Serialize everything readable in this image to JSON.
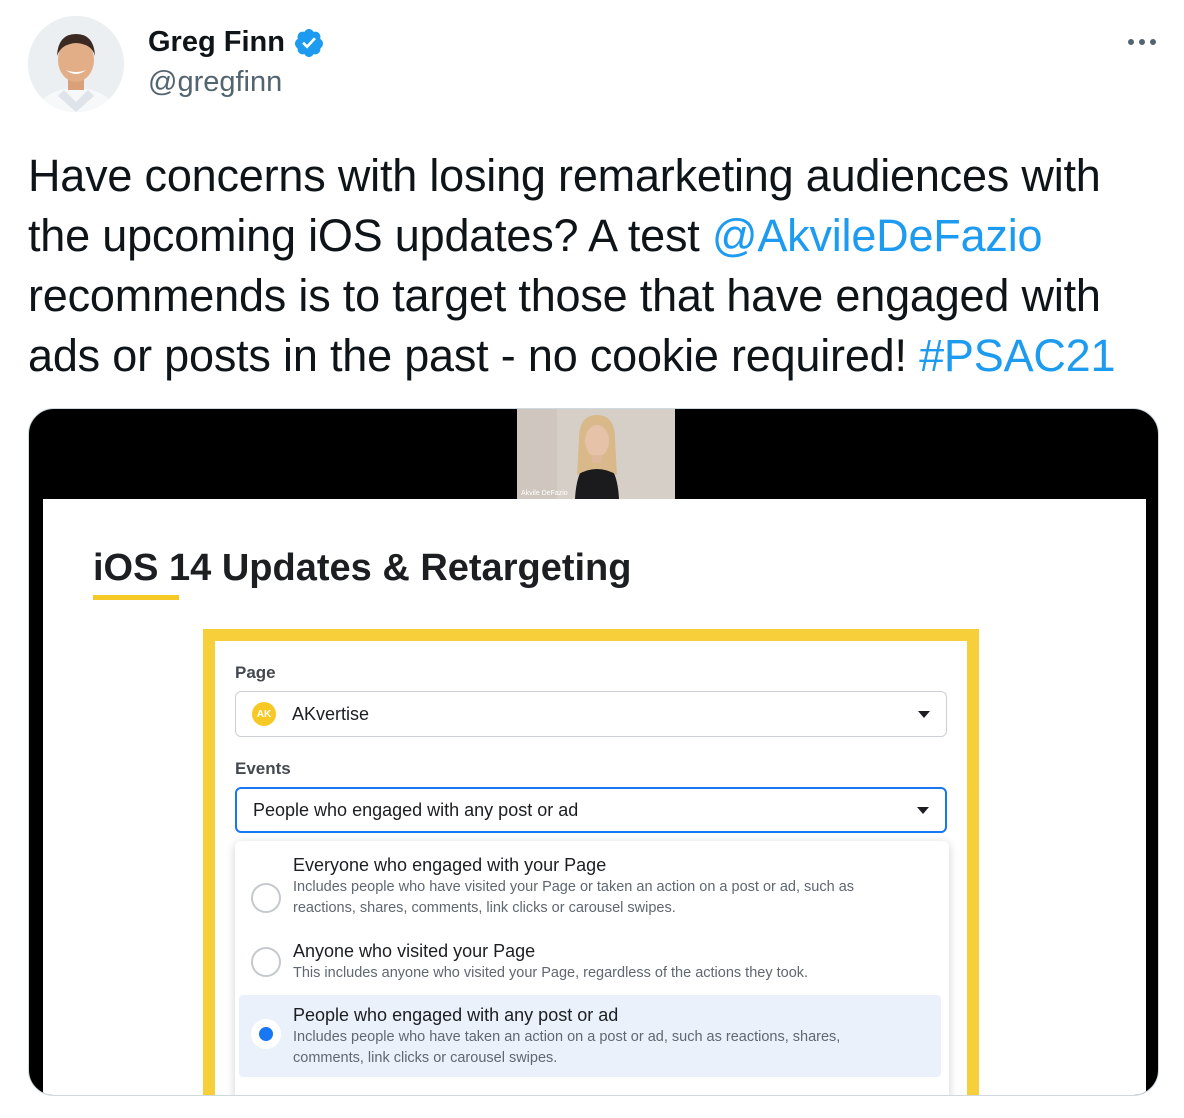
{
  "author": {
    "name": "Greg Finn",
    "handle": "@gregfinn"
  },
  "tweet": {
    "text_1": "Have concerns with losing remarketing audiences with the upcoming iOS updates? A test ",
    "mention": "@AkvileDeFazio",
    "text_2": " recommends is to target those that have engaged with ads or posts in the past - no cookie required!  ",
    "hashtag": "#PSAC21"
  },
  "media": {
    "webcam_caption": "Akvile DeFazio",
    "slide_title": "iOS 14 Updates & Retargeting",
    "form": {
      "page_label": "Page",
      "page_value": "AKvertise",
      "page_logo_text": "AK",
      "events_label": "Events",
      "events_value": "People who engaged with any post or ad",
      "options": [
        {
          "title": "Everyone who engaged with your Page",
          "desc": "Includes people who have visited your Page or taken an action on a post or ad, such as reactions, shares, comments, link clicks or carousel swipes."
        },
        {
          "title": "Anyone who visited your Page",
          "desc": "This includes anyone who visited your Page, regardless of the actions they took."
        },
        {
          "title": "People who engaged with any post or ad",
          "desc": "Includes people who have taken an action on a post or ad, such as reactions, shares, comments, link clicks or carousel swipes."
        }
      ],
      "selected_option": "People who engaged with any post or ad"
    }
  },
  "icons": {
    "verified": "verified-badge-icon",
    "more": "more-options-icon",
    "caret": "caret-down-icon",
    "page_logo": "akvertise-logo-icon"
  },
  "colors": {
    "link": "#1d9bf0",
    "verified": "#1d9bf0",
    "accent_yellow": "#f7c926",
    "facebook_blue": "#1877f2"
  }
}
